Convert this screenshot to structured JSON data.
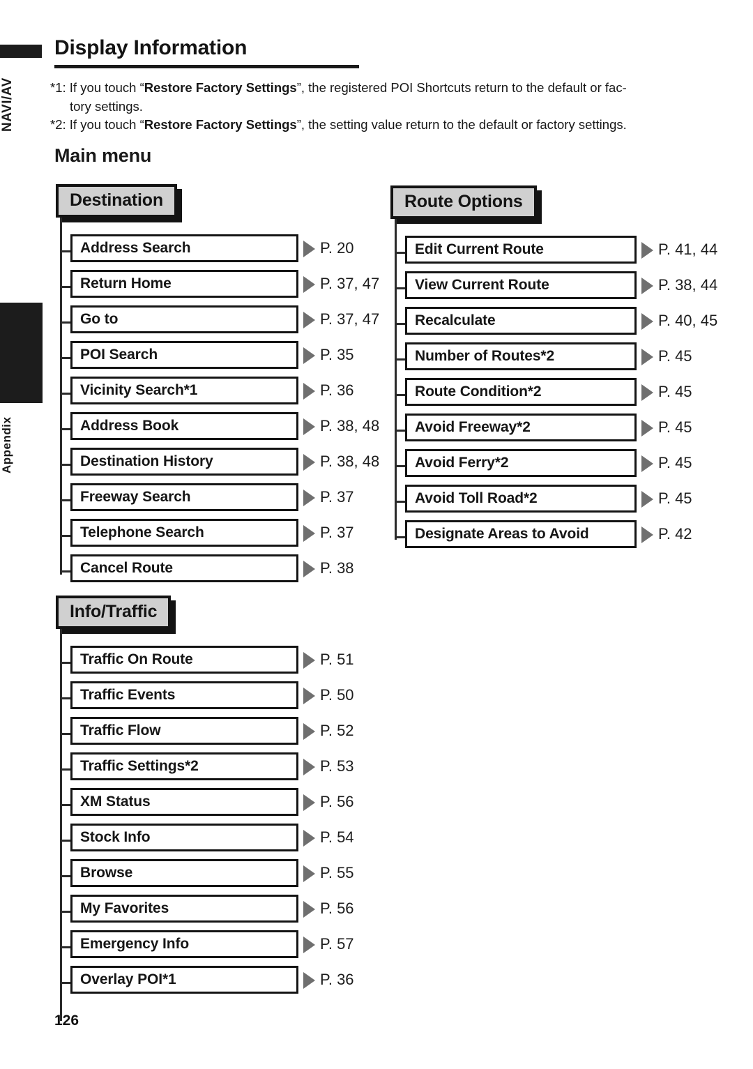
{
  "rail": {
    "navi_label": "NAVI/AV",
    "appendix_label": "Appendix"
  },
  "header": {
    "title": "Display Information"
  },
  "footnotes": [
    {
      "marker": "*1:",
      "text_before": " If you touch “",
      "bold": "Restore Factory Settings",
      "text_after": "”, the registered POI Shortcuts return to the default or fac-",
      "continuation": "tory settings."
    },
    {
      "marker": "*2:",
      "text_before": " If you touch “",
      "bold": "Restore Factory Settings",
      "text_after": "”, the setting value return to the default or factory settings.",
      "continuation": ""
    }
  ],
  "main_menu_heading": "Main menu",
  "groups": [
    {
      "id": "destination",
      "title": "Destination",
      "items": [
        {
          "label": "Address Search",
          "page": "P. 20"
        },
        {
          "label": "Return Home",
          "page": "P. 37, 47"
        },
        {
          "label": "Go to",
          "page": "P. 37, 47"
        },
        {
          "label": "POI Search",
          "page": "P. 35"
        },
        {
          "label": "Vicinity Search*1",
          "page": "P. 36"
        },
        {
          "label": "Address Book",
          "page": "P. 38, 48"
        },
        {
          "label": "Destination History",
          "page": "P. 38, 48"
        },
        {
          "label": "Freeway Search",
          "page": "P. 37"
        },
        {
          "label": "Telephone Search",
          "page": "P. 37"
        },
        {
          "label": "Cancel Route",
          "page": "P. 38"
        }
      ]
    },
    {
      "id": "route",
      "title": "Route Options",
      "items": [
        {
          "label": "Edit Current Route",
          "page": "P. 41, 44"
        },
        {
          "label": "View Current Route",
          "page": "P. 38, 44"
        },
        {
          "label": "Recalculate",
          "page": "P. 40, 45"
        },
        {
          "label": "Number of Routes*2",
          "page": "P. 45"
        },
        {
          "label": "Route Condition*2",
          "page": "P. 45"
        },
        {
          "label": "Avoid Freeway*2",
          "page": "P. 45"
        },
        {
          "label": "Avoid Ferry*2",
          "page": "P. 45"
        },
        {
          "label": "Avoid Toll Road*2",
          "page": "P. 45"
        },
        {
          "label": "Designate Areas to Avoid",
          "page": "P. 42"
        }
      ]
    },
    {
      "id": "info",
      "title": "Info/Traffic",
      "items": [
        {
          "label": "Traffic On Route",
          "page": "P. 51"
        },
        {
          "label": "Traffic Events",
          "page": "P. 50"
        },
        {
          "label": "Traffic Flow",
          "page": "P. 52"
        },
        {
          "label": "Traffic Settings*2",
          "page": "P. 53"
        },
        {
          "label": "XM Status",
          "page": "P. 56"
        },
        {
          "label": "Stock Info",
          "page": "P. 54"
        },
        {
          "label": "Browse",
          "page": "P. 55"
        },
        {
          "label": "My Favorites",
          "page": "P. 56"
        },
        {
          "label": "Emergency Info",
          "page": "P. 57"
        },
        {
          "label": "Overlay POI*1",
          "page": "P. 36"
        }
      ]
    }
  ],
  "footer": {
    "page_number": "126"
  },
  "colors": {
    "ink": "#1a1a1a",
    "chip_fill": "#d0d0d0",
    "arrow": "#6f6f6f"
  }
}
